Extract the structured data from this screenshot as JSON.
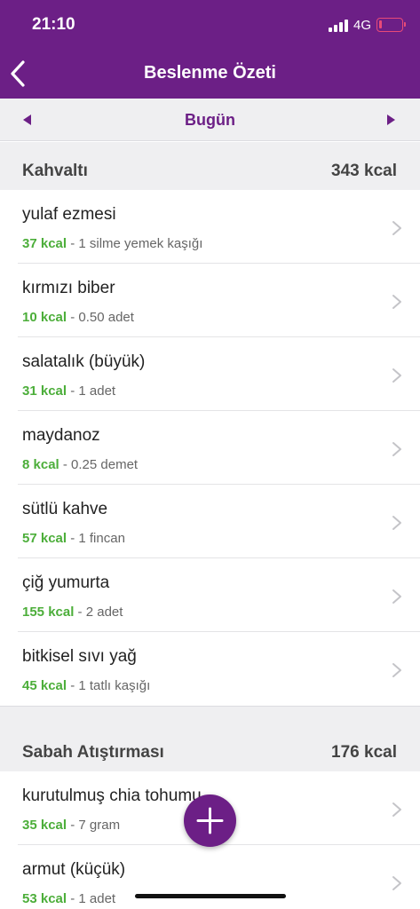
{
  "status_bar": {
    "time": "21:10",
    "network": "4G",
    "battery_color": "#e84a78"
  },
  "nav": {
    "title": "Beslenme Özeti",
    "back_icon": "chevron-left-icon"
  },
  "date_nav": {
    "label": "Bugün",
    "prev_icon": "triangle-left-icon",
    "next_icon": "triangle-right-icon"
  },
  "colors": {
    "brand": "#6c1f86",
    "kcal_green": "#4cae3a",
    "section_bg": "#efeff1"
  },
  "sections": [
    {
      "title": "Kahvaltı",
      "kcal": "343 kcal",
      "items": [
        {
          "name": "yulaf ezmesi",
          "kcal": "37 kcal",
          "detail": " - 1 silme yemek kaşığı"
        },
        {
          "name": "kırmızı biber",
          "kcal": "10 kcal",
          "detail": " - 0.50 adet"
        },
        {
          "name": "salatalık (büyük)",
          "kcal": "31 kcal",
          "detail": " - 1 adet"
        },
        {
          "name": "maydanoz",
          "kcal": "8 kcal",
          "detail": " - 0.25 demet"
        },
        {
          "name": "sütlü kahve",
          "kcal": "57 kcal",
          "detail": " - 1 fincan"
        },
        {
          "name": "çiğ yumurta",
          "kcal": "155 kcal",
          "detail": " - 2 adet"
        },
        {
          "name": "bitkisel sıvı yağ",
          "kcal": "45 kcal",
          "detail": " - 1 tatlı kaşığı"
        }
      ]
    },
    {
      "title": "Sabah Atıştırması",
      "kcal": "176 kcal",
      "items": [
        {
          "name": "kurutulmuş chia tohumu",
          "kcal": "35 kcal",
          "detail": " - 7 gram"
        },
        {
          "name": "armut (küçük)",
          "kcal": "53 kcal",
          "detail": " - 1 adet"
        }
      ]
    }
  ],
  "fab": {
    "icon": "plus-icon"
  }
}
